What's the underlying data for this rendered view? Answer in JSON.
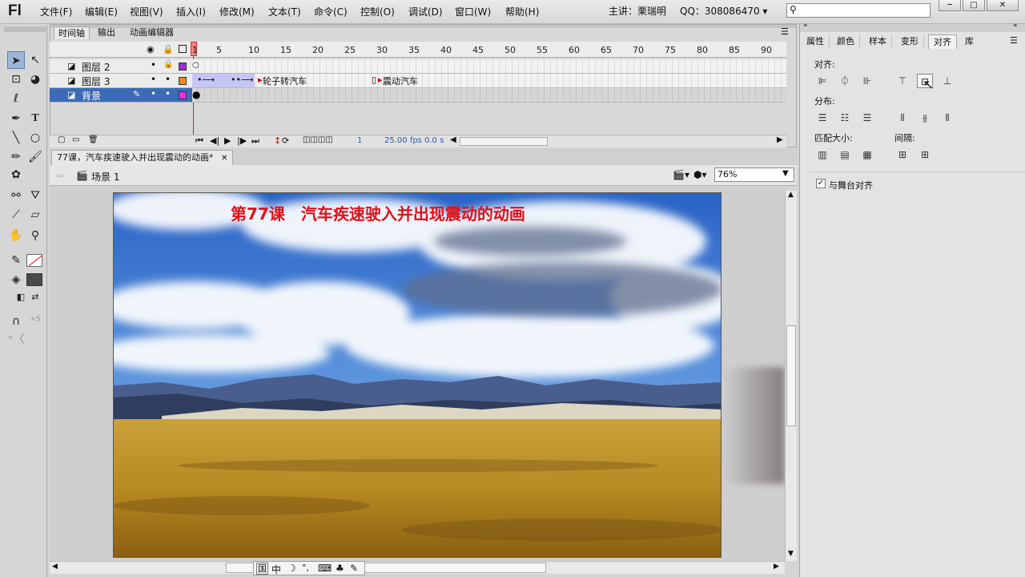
{
  "app": {
    "logo": "Fl",
    "presenter": "主讲：栗瑞明",
    "qq": "QQ：308086470 ▾",
    "win_min": "─",
    "win_max": "□",
    "win_close": "✕"
  },
  "menus": [
    "文件(F)",
    "编辑(E)",
    "视图(V)",
    "插入(I)",
    "修改(M)",
    "文本(T)",
    "命令(C)",
    "控制(O)",
    "调试(D)",
    "窗口(W)",
    "帮助(H)"
  ],
  "timeline": {
    "tabs": [
      "时间轴",
      "输出",
      "动画编辑器"
    ],
    "frame_numbers": [
      "1",
      "5",
      "10",
      "15",
      "20",
      "25",
      "30",
      "35",
      "40",
      "45",
      "50",
      "55",
      "60",
      "65",
      "70",
      "75",
      "80",
      "85",
      "90"
    ],
    "layers": [
      {
        "name": "图层 2",
        "color": "#9a2fd8"
      },
      {
        "name": "图层 3",
        "color": "#f08a1a"
      },
      {
        "name": "背景",
        "color": "#e632e6"
      }
    ],
    "label_wheel": "轮子转汽车",
    "label_shake": "震动汽车",
    "current_frame": "1",
    "fps": "25.00 fps",
    "time": "0.0 s"
  },
  "document": {
    "tab_title": "77课，汽车疾速驶入并出现震动的动画*",
    "tab_close": "✕",
    "scene": "场景 1",
    "zoom": "76%"
  },
  "stage": {
    "title": "第77课　汽车疾速驶入并出现震动的动画",
    "title_color": "#e0101a"
  },
  "panel": {
    "tabs": [
      "属性",
      "颜色",
      "样本",
      "变形",
      "对齐",
      "库"
    ],
    "align_label": "对齐:",
    "distribute_label": "分布:",
    "match_label": "匹配大小:",
    "spacing_label": "间隔:",
    "stage_align_label": "与舞台对齐",
    "stage_align_checked": true
  },
  "ime": {
    "items": [
      "中",
      "☽",
      "°,",
      "⌨",
      "♣",
      "✎"
    ]
  }
}
